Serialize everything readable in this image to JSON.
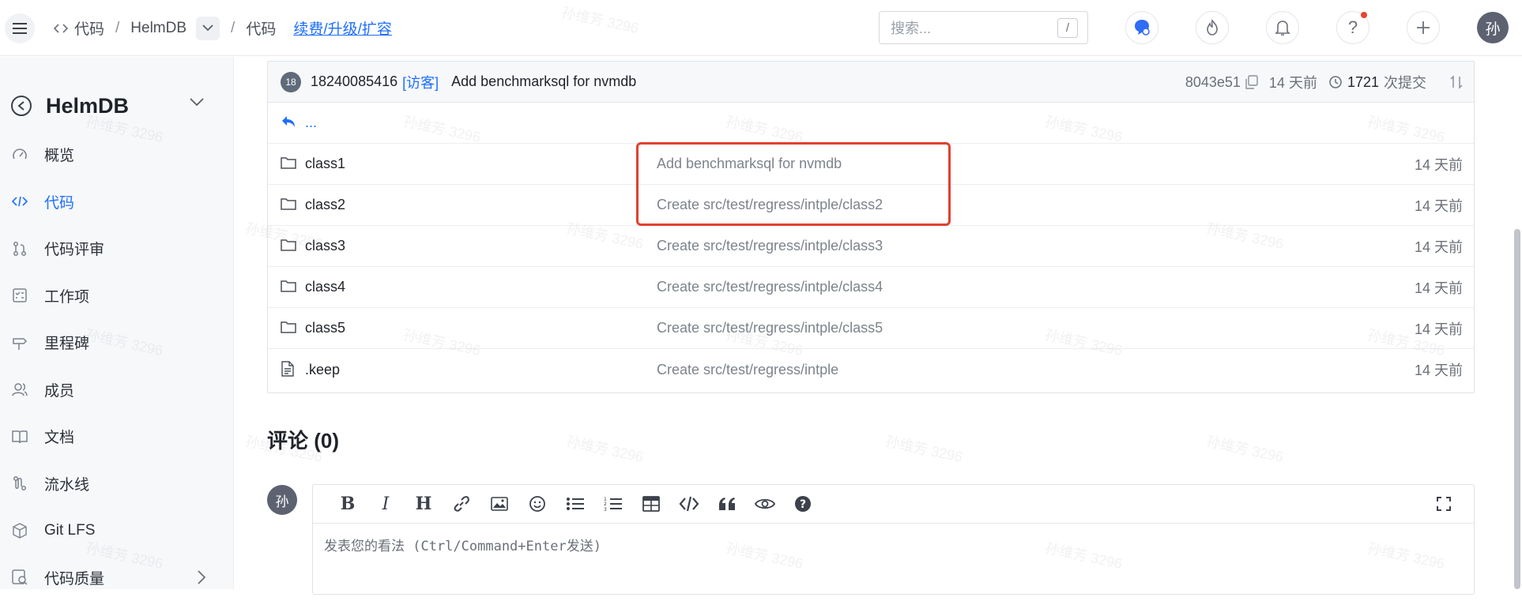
{
  "topbar": {
    "crumb_code_1": "代码",
    "crumb_repo": "HelmDB",
    "crumb_code_2": "代码",
    "crumb_link": "续费/升级/扩容",
    "search_placeholder": "搜索...",
    "search_shortcut": "/",
    "user_avatar": "孙"
  },
  "sidebar": {
    "repo_name": "HelmDB",
    "items": [
      {
        "label": "概览",
        "icon": "dashboard-icon"
      },
      {
        "label": "代码",
        "icon": "code-icon",
        "active": true
      },
      {
        "label": "代码评审",
        "icon": "pull-request-icon"
      },
      {
        "label": "工作项",
        "icon": "task-list-icon"
      },
      {
        "label": "里程碑",
        "icon": "milestone-icon"
      },
      {
        "label": "成员",
        "icon": "members-icon"
      },
      {
        "label": "文档",
        "icon": "book-icon"
      },
      {
        "label": "流水线",
        "icon": "pipeline-icon"
      },
      {
        "label": "Git LFS",
        "icon": "cube-icon"
      },
      {
        "label": "代码质量",
        "icon": "quality-icon"
      }
    ]
  },
  "commit": {
    "avatar_text": "18",
    "author": "18240085416",
    "role": "[访客]",
    "message": "Add benchmarksql for nvmdb",
    "sha": "8043e51",
    "time": "14 天前",
    "count": "1721",
    "count_label": "次提交"
  },
  "files": {
    "parent": "...",
    "rows": [
      {
        "name": "class1",
        "type": "folder",
        "message": "Add benchmarksql for nvmdb",
        "time": "14 天前"
      },
      {
        "name": "class2",
        "type": "folder",
        "message": "Create src/test/regress/intple/class2",
        "time": "14 天前"
      },
      {
        "name": "class3",
        "type": "folder",
        "message": "Create src/test/regress/intple/class3",
        "time": "14 天前"
      },
      {
        "name": "class4",
        "type": "folder",
        "message": "Create src/test/regress/intple/class4",
        "time": "14 天前"
      },
      {
        "name": "class5",
        "type": "folder",
        "message": "Create src/test/regress/intple/class5",
        "time": "14 天前"
      },
      {
        "name": ".keep",
        "type": "file",
        "message": "Create src/test/regress/intple",
        "time": "14 天前"
      }
    ]
  },
  "comments": {
    "title": "评论 (0)",
    "avatar": "孙",
    "placeholder": "发表您的看法 (Ctrl/Command+Enter发送)",
    "toolbar": {
      "bold": "B",
      "italic": "I",
      "heading": "H"
    }
  },
  "watermark_text": "孙维芳 3296",
  "colors": {
    "accent": "#1e6fff",
    "highlight": "#e0412f",
    "sidebar_bg": "#f7f8fa"
  }
}
